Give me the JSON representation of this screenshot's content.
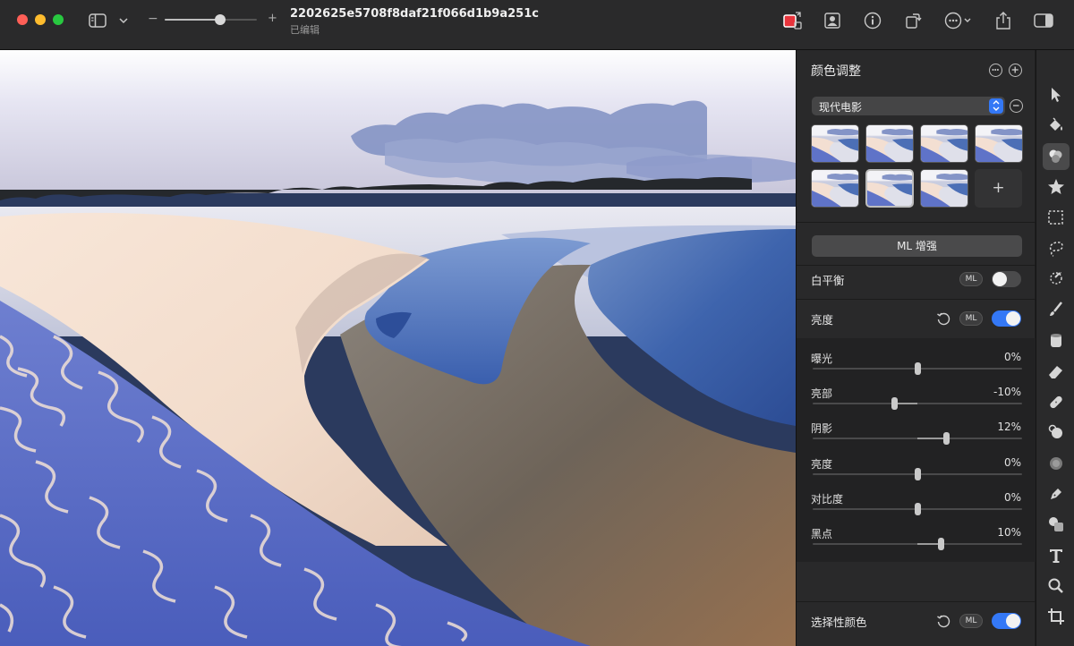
{
  "window": {
    "title": "2202625e5708f8daf21f066d1b9a251c",
    "subtitle": "已编辑"
  },
  "zoom": {
    "level": 0.6,
    "minus": "−",
    "plus": "+"
  },
  "titlebar_icons": [
    "sidebar-toggle-icon",
    "chevron-down-icon",
    "color-swap-icon",
    "portrait-icon",
    "info-icon",
    "rotate-icon",
    "more-icon",
    "share-icon",
    "inspector-toggle-icon"
  ],
  "panel": {
    "title": "颜色调整",
    "preset_select": {
      "value": "现代电影"
    },
    "thumbnails": [
      {
        "selected": false
      },
      {
        "selected": false
      },
      {
        "selected": false
      },
      {
        "selected": false
      },
      {
        "selected": false
      },
      {
        "selected": true
      },
      {
        "selected": false
      }
    ],
    "add_label": "+",
    "ml_enhance_label": "ML 增强",
    "white_balance": {
      "label": "白平衡",
      "ml_label": "ML",
      "enabled": false
    },
    "brightness": {
      "label": "亮度",
      "ml_label": "ML",
      "enabled": true,
      "sliders": [
        {
          "name": "曝光",
          "value": "0%",
          "level": 0.0
        },
        {
          "name": "亮部",
          "value": "-10%",
          "level": -0.1
        },
        {
          "name": "阴影",
          "value": "12%",
          "level": 0.12
        },
        {
          "name": "亮度",
          "value": "0%",
          "level": 0.0
        },
        {
          "name": "对比度",
          "value": "0%",
          "level": 0.0
        },
        {
          "name": "黑点",
          "value": "10%",
          "level": 0.1
        }
      ]
    },
    "selective_color": {
      "label": "选择性颜色",
      "ml_label": "ML",
      "enabled": true
    }
  },
  "tools": [
    {
      "name": "arrow-tool-icon",
      "active": false
    },
    {
      "name": "paint-bucket-tool-icon",
      "active": false
    },
    {
      "name": "color-adjust-tool-icon",
      "active": true
    },
    {
      "name": "star-tool-icon",
      "active": false
    },
    {
      "name": "rect-select-tool-icon",
      "active": false
    },
    {
      "name": "lasso-tool-icon",
      "active": false
    },
    {
      "name": "magic-wand-tool-icon",
      "active": false
    },
    {
      "name": "brush-tool-icon",
      "active": false
    },
    {
      "name": "fill-tool-icon",
      "active": false
    },
    {
      "name": "eraser-tool-icon",
      "active": false
    },
    {
      "name": "bandage-tool-icon",
      "active": false
    },
    {
      "name": "clone-tool-icon",
      "active": false
    },
    {
      "name": "blur-tool-icon",
      "active": false
    },
    {
      "name": "pen-tool-icon",
      "active": false
    },
    {
      "name": "shapes-tool-icon",
      "active": false
    },
    {
      "name": "text-tool-icon",
      "active": false
    },
    {
      "name": "zoom-tool-icon",
      "active": false
    },
    {
      "name": "crop-tool-icon",
      "active": false
    }
  ],
  "colors": {
    "accent": "#3478f6",
    "panel": "#29292a",
    "titlebar": "#2a2a2b"
  }
}
